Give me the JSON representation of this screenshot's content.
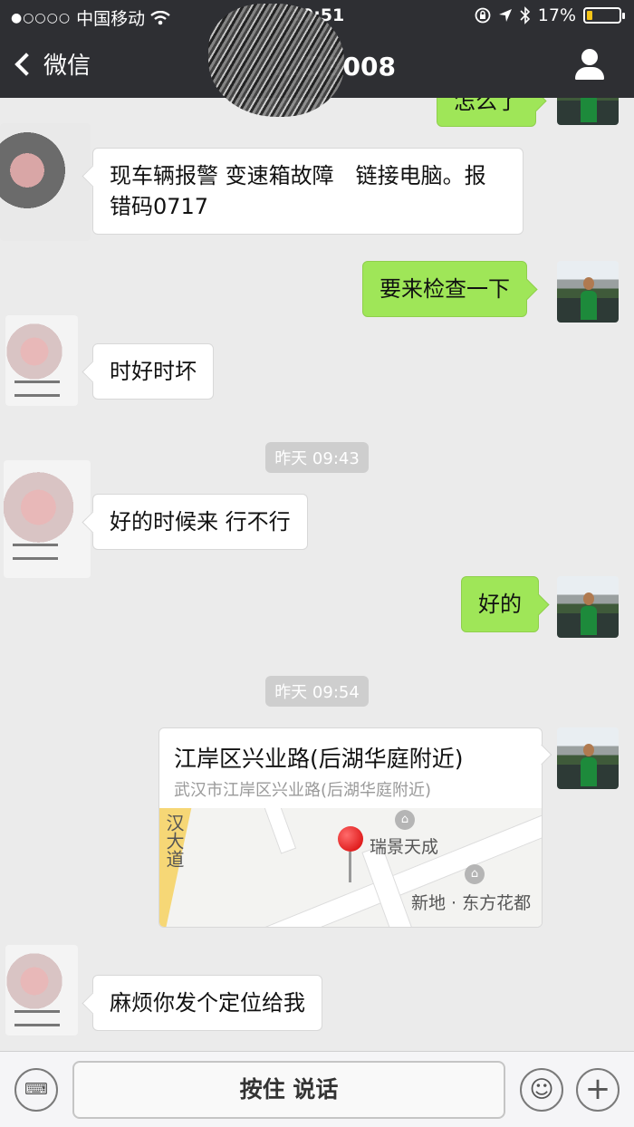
{
  "status_bar": {
    "signal": "●○○○○",
    "carrier": "中国移动",
    "wifi_icon": "wifi-icon",
    "time": "20:51",
    "battery_text": "17%",
    "battery_level": 0.17
  },
  "nav": {
    "back_label": "微信",
    "title": "…口3008"
  },
  "chat": {
    "top_partial": "怎么了",
    "messages": [
      {
        "side": "in",
        "text": "现车辆报警 变速箱故障　链接电脑。报错码0717"
      },
      {
        "side": "out",
        "text": "要来检查一下"
      },
      {
        "side": "in",
        "text": "时好时坏"
      },
      {
        "type": "time",
        "text": "昨天 09:43"
      },
      {
        "side": "in",
        "text": "好的时候来 行不行"
      },
      {
        "side": "out",
        "text": "好的"
      },
      {
        "type": "time",
        "text": "昨天 09:54"
      },
      {
        "side": "out",
        "type": "location",
        "title": "江岸区兴业路(后湖华庭附近)",
        "address": "武汉市江岸区兴业路(后湖华庭附近)",
        "map_labels": [
          "汉大道",
          "瑞景天成",
          "新地 · 东方花都"
        ]
      },
      {
        "side": "in",
        "text": "麻烦你发个定位给我"
      }
    ]
  },
  "input": {
    "talk_label": "按住 说话",
    "keyboard_icon": "keyboard-icon",
    "emoji_icon": "emoji-icon",
    "plus_icon": "plus-icon"
  },
  "colors": {
    "nav_bg": "#2e2f33",
    "bubble_out": "#9fe658",
    "bubble_in": "#ffffff",
    "chat_bg": "#ebebeb"
  }
}
